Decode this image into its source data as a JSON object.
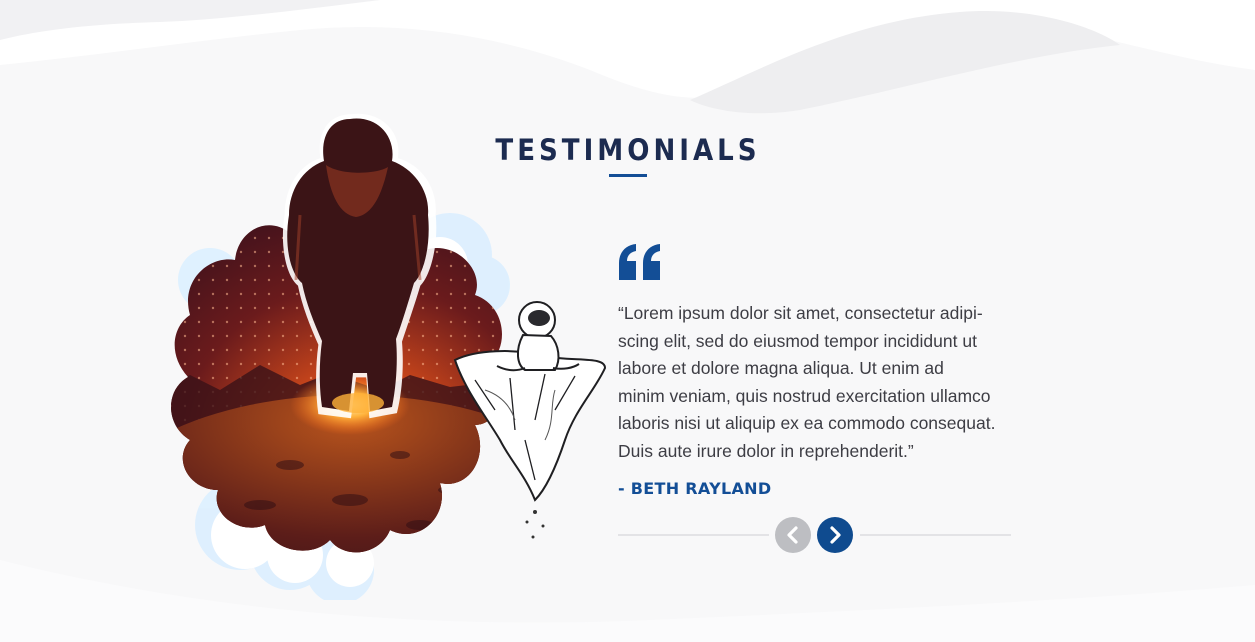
{
  "section": {
    "title": "TESTIMONIALS"
  },
  "testimonial": {
    "quote_lines": [
      "“Lorem ipsum dolor sit amet, consectetur adipi-",
      "scing elit, sed do eiusmod tempor incididunt ut",
      "labore et dolore magna aliqua. Ut enim ad",
      "minim veniam, quis nostrud exercitation ullamco",
      "laboris nisi ut aliquip ex ea commodo consequat.",
      "Duis aute irure dolor in reprehenderit.”"
    ],
    "author": "- BETH RAYLAND"
  },
  "icons": {
    "quote": "quote-icon",
    "prev": "chevron-left-icon",
    "next": "chevron-right-icon"
  },
  "colors": {
    "title": "#1c2b50",
    "accent": "#134e96",
    "text": "#3d3d44",
    "nav_inactive": "#bdbec2",
    "nav_active": "#0f4b8f"
  }
}
